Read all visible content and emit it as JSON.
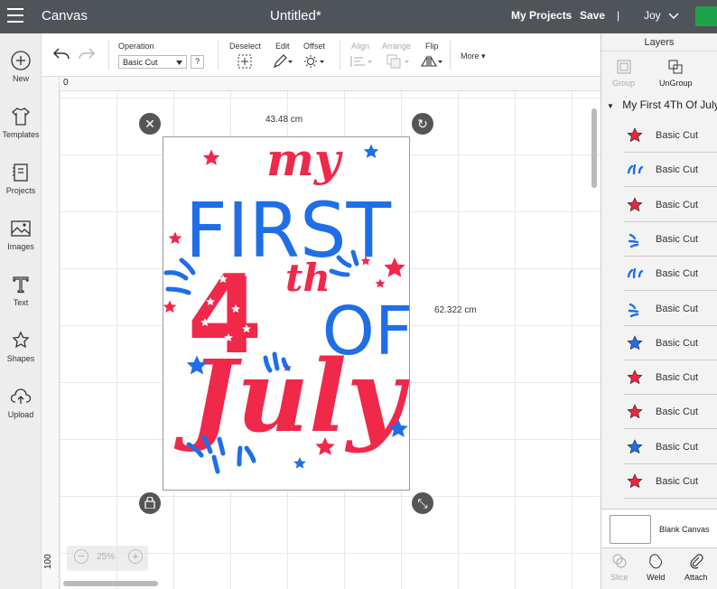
{
  "topbar": {
    "app": "Canvas",
    "doc_title": "Untitled*",
    "my_projects": "My Projects",
    "save": "Save",
    "separator": "|",
    "user": "Joy"
  },
  "leftnav": [
    {
      "label": "New",
      "icon": "plus-icon"
    },
    {
      "label": "Templates",
      "icon": "shirt-icon"
    },
    {
      "label": "Projects",
      "icon": "projects-icon"
    },
    {
      "label": "Images",
      "icon": "images-icon"
    },
    {
      "label": "Text",
      "icon": "text-icon"
    },
    {
      "label": "Shapes",
      "icon": "shapes-icon"
    },
    {
      "label": "Upload",
      "icon": "upload-icon"
    }
  ],
  "toolbar": {
    "operation_label": "Operation",
    "operation_value": "Basic Cut",
    "help": "?",
    "deselect": "Deselect",
    "edit": "Edit",
    "offset": "Offset",
    "align": "Align",
    "arrange": "Arrange",
    "flip": "Flip",
    "more": "More"
  },
  "ruler": {
    "top_zero": "0",
    "left_100": "100"
  },
  "selection": {
    "width_label": "43.48 cm",
    "height_label": "62.322 cm"
  },
  "design": {
    "line1": "my",
    "line2": "FIRST",
    "line3_number": "4",
    "line3_suffix": "th",
    "line3_of": "OF",
    "line4": "July",
    "colors": {
      "red": "#f0284a",
      "blue": "#1f6ee8"
    }
  },
  "zoom": {
    "minus": "−",
    "value": "25%",
    "plus": "+"
  },
  "layers_panel": {
    "title": "Layers",
    "group": "Group",
    "ungroup": "UnGroup",
    "project_name": "My First 4Th Of July",
    "items": [
      {
        "name": "Basic Cut",
        "color": "#e8283c",
        "shape": "star"
      },
      {
        "name": "Basic Cut",
        "color": "#1f6ee8",
        "shape": "burst"
      },
      {
        "name": "Basic Cut",
        "color": "#e8283c",
        "shape": "star"
      },
      {
        "name": "Basic Cut",
        "color": "#1f6ee8",
        "shape": "swirl"
      },
      {
        "name": "Basic Cut",
        "color": "#1f6ee8",
        "shape": "burst"
      },
      {
        "name": "Basic Cut",
        "color": "#1f6ee8",
        "shape": "swirl"
      },
      {
        "name": "Basic Cut",
        "color": "#1f6ee8",
        "shape": "star"
      },
      {
        "name": "Basic Cut",
        "color": "#e8283c",
        "shape": "star"
      },
      {
        "name": "Basic Cut",
        "color": "#e8283c",
        "shape": "star"
      },
      {
        "name": "Basic Cut",
        "color": "#1f6ee8",
        "shape": "star"
      },
      {
        "name": "Basic Cut",
        "color": "#e8283c",
        "shape": "star"
      }
    ],
    "blank_canvas": "Blank Canvas",
    "slice": "Slice",
    "weld": "Weld",
    "attach": "Attach"
  }
}
